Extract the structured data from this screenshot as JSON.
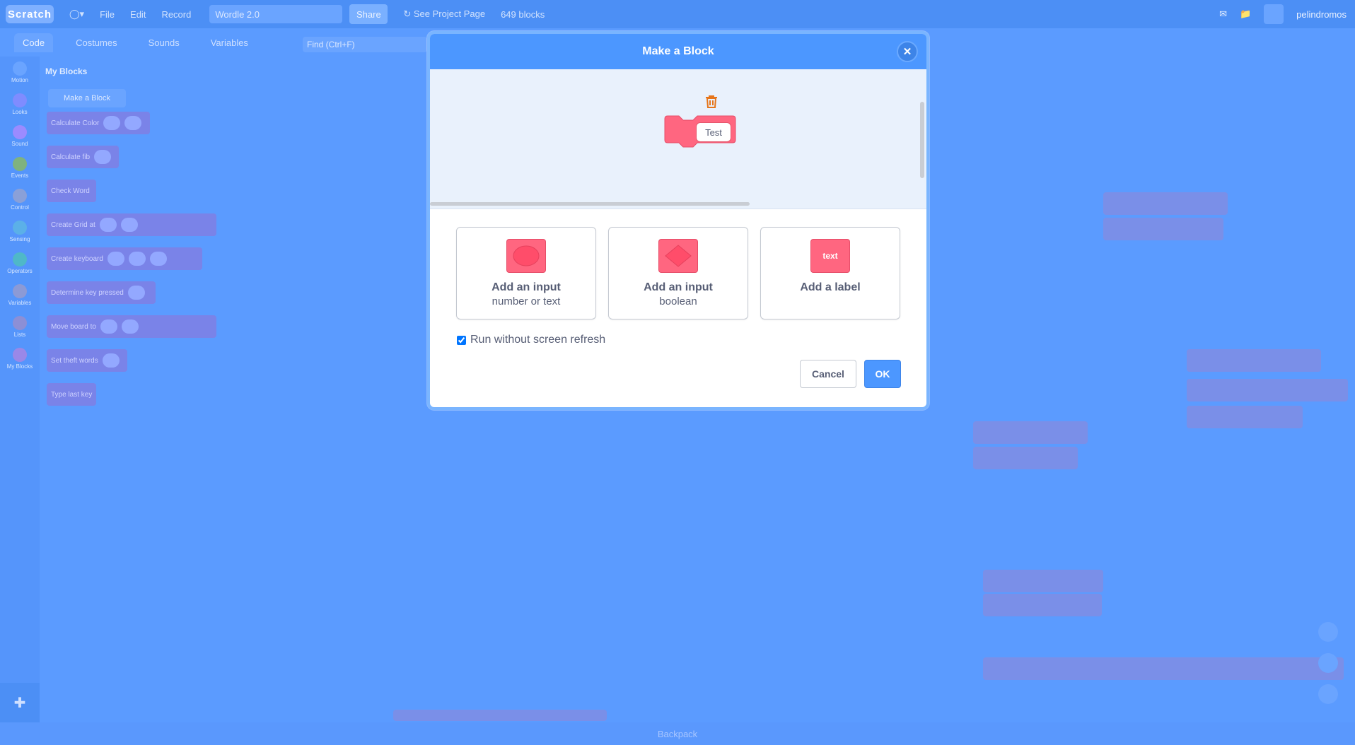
{
  "app": {
    "menu": [
      "File",
      "Edit",
      "Record"
    ],
    "project_title": "Wordle 2.0",
    "share_label": "Share",
    "see_project_page": "See Project Page",
    "block_count": "649 blocks",
    "username": "pelindromos"
  },
  "editor": {
    "tabs": [
      "Code",
      "Costumes",
      "Sounds",
      "Variables"
    ],
    "find_placeholder": "Find (Ctrl+F)",
    "categories": [
      {
        "label": "Motion",
        "color": "#4c97ff"
      },
      {
        "label": "Looks",
        "color": "#9966ff"
      },
      {
        "label": "Sound",
        "color": "#cf63cf"
      },
      {
        "label": "Events",
        "color": "#ffbf00"
      },
      {
        "label": "Control",
        "color": "#ffab19"
      },
      {
        "label": "Sensing",
        "color": "#5cb1d6"
      },
      {
        "label": "Operators",
        "color": "#59c059"
      },
      {
        "label": "Variables",
        "color": "#ff8c1a"
      },
      {
        "label": "Lists",
        "color": "#ff661a"
      },
      {
        "label": "My Blocks",
        "color": "#ff6680"
      }
    ],
    "palette_title": "My Blocks",
    "make_block_label": "Make a Block",
    "palette_blocks": [
      "Calculate Color",
      "Calculate fib",
      "Check Word",
      "Create Grid at",
      "Create keyboard",
      "Determine key pressed",
      "Move board to",
      "Set theft words",
      "Type last key"
    ],
    "backpack_label": "Backpack"
  },
  "modal": {
    "title": "Make a Block",
    "block_text": "Test",
    "options": [
      {
        "title": "Add an input",
        "subtitle": "number or text",
        "icon": "round-input-icon"
      },
      {
        "title": "Add an input",
        "subtitle": "boolean",
        "icon": "boolean-input-icon"
      },
      {
        "title": "Add a label",
        "subtitle": "",
        "icon": "label-icon",
        "icon_text": "text"
      }
    ],
    "run_without_refresh_label": "Run without screen refresh",
    "run_without_refresh_checked": true,
    "cancel_label": "Cancel",
    "ok_label": "OK",
    "colors": {
      "header": "#4c97ff",
      "block": "#ff6680",
      "trash": "#e6751a"
    }
  }
}
